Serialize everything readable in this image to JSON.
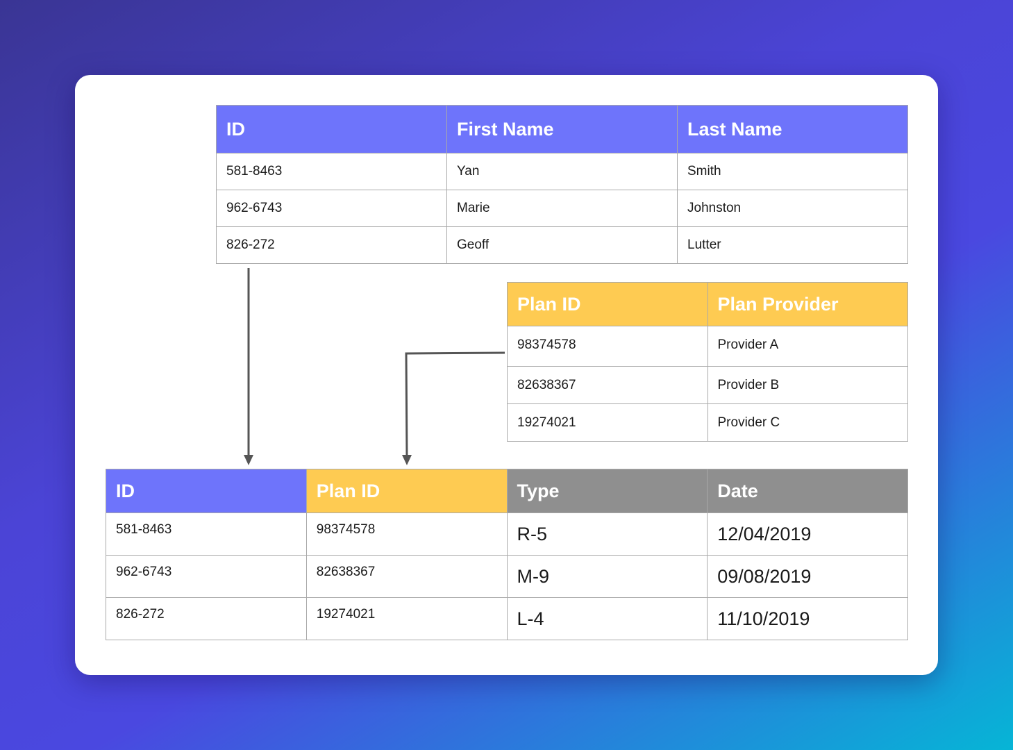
{
  "tables": {
    "people": {
      "headers": [
        "ID",
        "First Name",
        "Last Name"
      ],
      "rows": [
        [
          "581-8463",
          "Yan",
          "Smith"
        ],
        [
          "962-6743",
          "Marie",
          "Johnston"
        ],
        [
          "826-272",
          "Geoff",
          "Lutter"
        ]
      ]
    },
    "plans": {
      "headers": [
        "Plan ID",
        "Plan Provider"
      ],
      "rows": [
        [
          "98374578",
          "Provider A"
        ],
        [
          "82638367",
          "Provider B"
        ],
        [
          "19274021",
          "Provider C"
        ]
      ]
    },
    "joined": {
      "headers": [
        "ID",
        "Plan ID",
        "Type",
        "Date"
      ],
      "rows": [
        [
          "581-8463",
          "98374578",
          "R-5",
          "12/04/2019"
        ],
        [
          "962-6743",
          "82638367",
          "M-9",
          "09/08/2019"
        ],
        [
          "826-272",
          "19274021",
          "L-4",
          "11/10/2019"
        ]
      ]
    }
  },
  "colors": {
    "id_header": "#6e74fb",
    "plan_header": "#fecb52",
    "detail_header": "#8f8f8f",
    "connector": "#555555"
  }
}
